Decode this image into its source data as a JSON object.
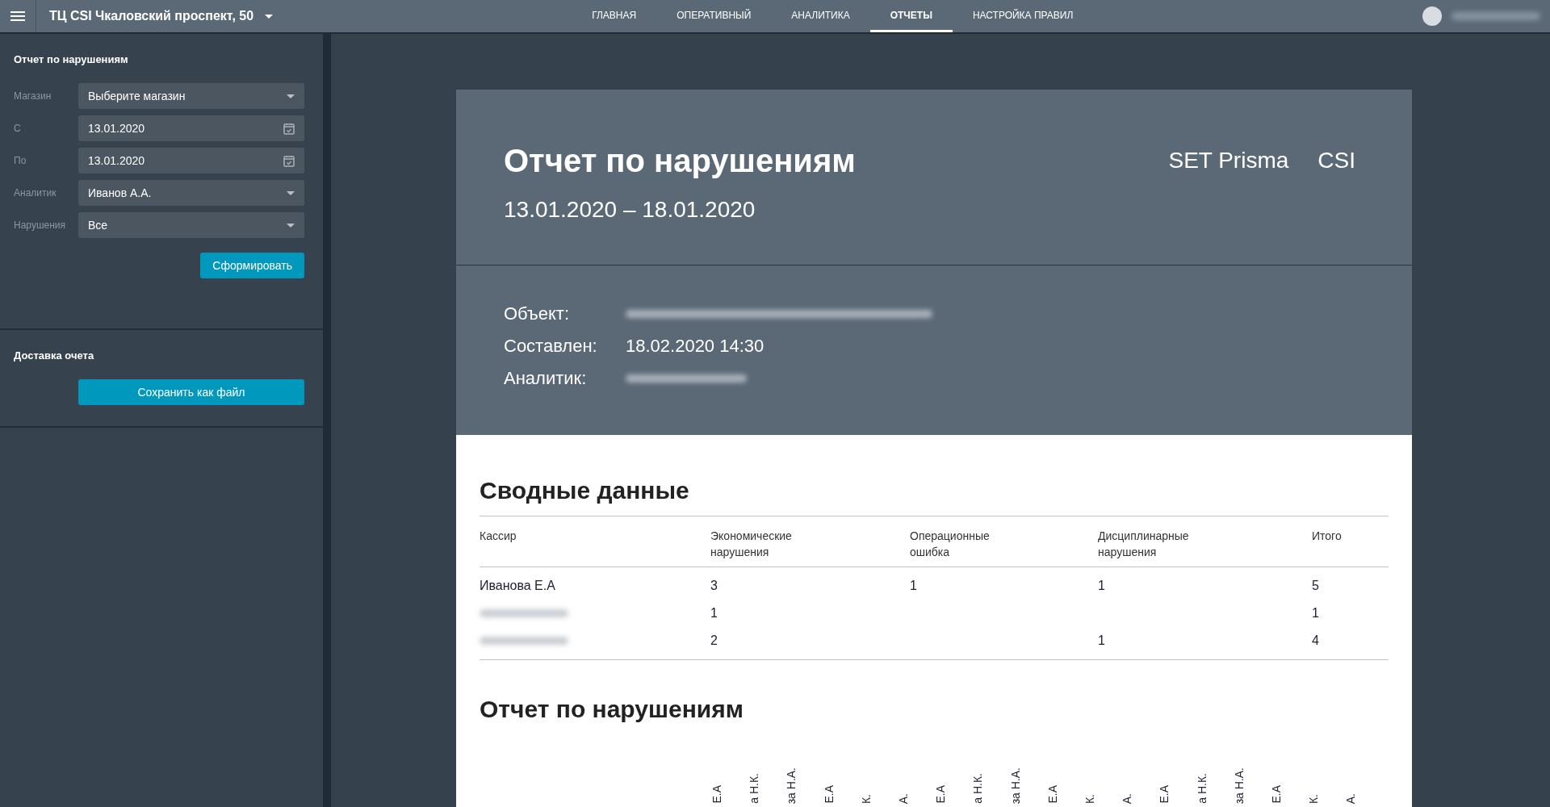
{
  "topbar": {
    "store": "ТЦ CSI Чкаловский проспект, 50",
    "nav": [
      {
        "label": "ГЛАВНАЯ",
        "selected": false
      },
      {
        "label": "ОПЕРАТИВНЫЙ",
        "selected": false
      },
      {
        "label": "АНАЛИТИКА",
        "selected": false
      },
      {
        "label": "ОТЧЕТЫ",
        "selected": true
      },
      {
        "label": "НАСТРОЙКА ПРАВИЛ",
        "selected": false
      }
    ]
  },
  "sidebar": {
    "title": "Отчет по нарушениям",
    "fields": [
      {
        "label": "Магазин",
        "value": "Выберите магазин",
        "kind": "select"
      },
      {
        "label": "С",
        "value": "13.01.2020",
        "kind": "date"
      },
      {
        "label": "По",
        "value": "13.01.2020",
        "kind": "date"
      },
      {
        "label": "Аналитик",
        "value": "Иванов А.А.",
        "kind": "select"
      },
      {
        "label": "Нарушения",
        "value": "Все",
        "kind": "select"
      }
    ],
    "submit": "Сформировать",
    "delivery_title": "Доставка очета",
    "save": "Сохранить как файл"
  },
  "report": {
    "title": "Отчет по нарушениям",
    "period": "13.01.2020 – 18.01.2020",
    "brands": [
      "SET Prisma",
      "CSI"
    ],
    "info": [
      {
        "label": "Объект:",
        "redacted": true
      },
      {
        "label": "Составлен:",
        "value": "18.02.2020 14:30"
      },
      {
        "label": "Аналитик:",
        "redacted": true
      }
    ],
    "summary_title": "Сводные данные",
    "columns": [
      "Кассир",
      "Экономические нарушения",
      "Операционные ошибка",
      "Дисциплинарные нарушения",
      "Итого"
    ],
    "rows": [
      {
        "name_redacted": false,
        "cells": [
          "Иванова Е.А",
          "3",
          "1",
          "1",
          "5"
        ]
      },
      {
        "name_redacted": true,
        "cells": [
          "",
          "1",
          "",
          "",
          "1"
        ]
      },
      {
        "name_redacted": true,
        "cells": [
          "",
          "2",
          "",
          "1",
          "4"
        ]
      }
    ],
    "violations_title": "Отчет по нарушениям",
    "rotated_labels": [
      "Е.А",
      "а Н.К.",
      "за Н.А.",
      "Е.А",
      "К.",
      "А.",
      "Е.А",
      "а Н.К.",
      "за Н.А.",
      "Е.А",
      "К.",
      "А.",
      "Е.А",
      "а Н.К.",
      "за Н.А.",
      "Е.А",
      "К.",
      "А."
    ]
  }
}
